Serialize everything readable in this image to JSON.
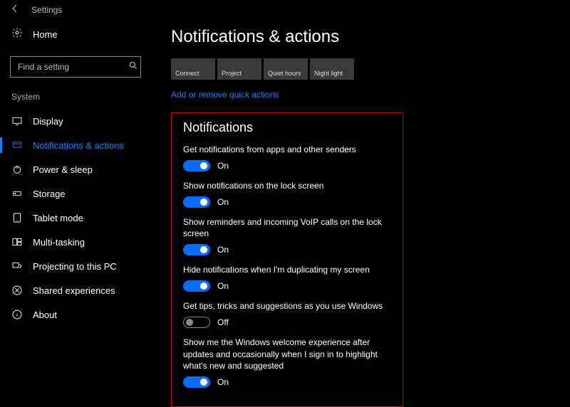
{
  "titlebar": {
    "app": "Settings"
  },
  "sidebar": {
    "home": "Home",
    "search_placeholder": "Find a setting",
    "section": "System",
    "items": [
      {
        "label": "Display"
      },
      {
        "label": "Notifications & actions"
      },
      {
        "label": "Power & sleep"
      },
      {
        "label": "Storage"
      },
      {
        "label": "Tablet mode"
      },
      {
        "label": "Multi-tasking"
      },
      {
        "label": "Projecting to this PC"
      },
      {
        "label": "Shared experiences"
      },
      {
        "label": "About"
      }
    ]
  },
  "main": {
    "title": "Notifications & actions",
    "tiles": [
      {
        "label": "Connect"
      },
      {
        "label": "Project"
      },
      {
        "label": "Quiet hours"
      },
      {
        "label": "Night light"
      }
    ],
    "edit_link": "Add or remove quick actions",
    "section_heading": "Notifications",
    "settings": [
      {
        "desc": "Get notifications from apps and other senders",
        "on": true,
        "label": "On"
      },
      {
        "desc": "Show notifications on the lock screen",
        "on": true,
        "label": "On"
      },
      {
        "desc": "Show reminders and incoming VoIP calls on the lock screen",
        "on": true,
        "label": "On"
      },
      {
        "desc": "Hide notifications when I'm duplicating my screen",
        "on": true,
        "label": "On"
      },
      {
        "desc": "Get tips, tricks and suggestions as you use Windows",
        "on": false,
        "label": "Off"
      },
      {
        "desc": "Show me the Windows welcome experience after updates and occasionally when I sign in to highlight what's new and suggested",
        "on": true,
        "label": "On"
      }
    ]
  }
}
